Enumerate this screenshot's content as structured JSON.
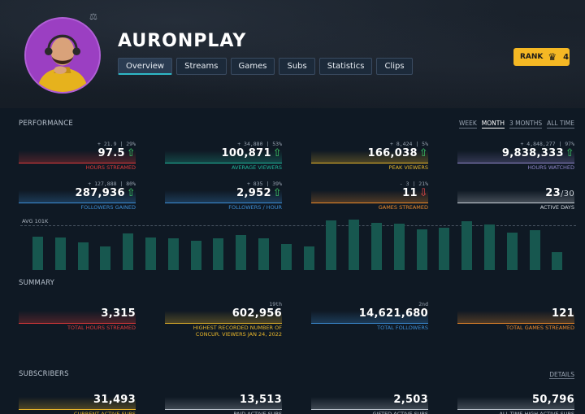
{
  "channel": {
    "name": "AURONPLAY"
  },
  "tabs": [
    {
      "label": "Overview",
      "active": true
    },
    {
      "label": "Streams",
      "active": false
    },
    {
      "label": "Games",
      "active": false
    },
    {
      "label": "Subs",
      "active": false
    },
    {
      "label": "Statistics",
      "active": false
    },
    {
      "label": "Clips",
      "active": false
    }
  ],
  "rank": {
    "label": "RANK",
    "value": "4",
    "icon": "crown-icon",
    "color": "#f5b824"
  },
  "performance": {
    "title": "PERFORMANCE",
    "ranges": [
      {
        "label": "WEEK",
        "active": false
      },
      {
        "label": "MONTH",
        "active": true
      },
      {
        "label": "3 MONTHS",
        "active": false
      },
      {
        "label": "ALL TIME",
        "active": false
      }
    ],
    "stats": [
      {
        "delta": "+ 21.9 | 29%",
        "value": "97.5",
        "trend": "up",
        "label": "HOURS STREAMED",
        "color": "#e23a3a"
      },
      {
        "delta": "+ 34,880 | 53%",
        "value": "100,871",
        "trend": "up",
        "label": "AVERAGE VIEWERS",
        "color": "#1fb59a"
      },
      {
        "delta": "+ 8,424 | 5%",
        "value": "166,038",
        "trend": "up",
        "label": "PEAK VIEWERS",
        "color": "#e8b62a"
      },
      {
        "delta": "+ 4,848,277 | 97%",
        "value": "9,838,333",
        "trend": "up",
        "label": "HOURS WATCHED",
        "color": "#8f86c9"
      },
      {
        "delta": "+ 127,888 | 80%",
        "value": "287,936",
        "trend": "up",
        "label": "FOLLOWERS GAINED",
        "color": "#3d8fd8"
      },
      {
        "delta": "+ 835 | 39%",
        "value": "2,952",
        "trend": "up",
        "label": "FOLLOWERS / HOUR",
        "color": "#3d8fd8"
      },
      {
        "delta": "- 3 | 21%",
        "value": "11",
        "trend": "down",
        "label": "GAMES STREAMED",
        "color": "#ef8b2a"
      },
      {
        "delta": "",
        "value": "23",
        "value_sub": "/30",
        "trend": "",
        "label": "ACTIVE DAYS",
        "color": "#cfd5dc"
      }
    ]
  },
  "chart_data": {
    "type": "bar",
    "avg_label": "AVG 101K",
    "avg_value": 101,
    "ylim": [
      0,
      125
    ],
    "values": [
      76,
      73,
      62,
      53,
      82,
      74,
      72,
      67,
      71,
      79,
      72,
      58,
      54,
      112,
      114,
      107,
      104,
      92,
      95,
      110,
      103,
      84,
      90,
      41
    ],
    "bar_color": "#17574f"
  },
  "summary": {
    "title": "SUMMARY",
    "stats": [
      {
        "rank": "",
        "value": "3,315",
        "label": "TOTAL HOURS STREAMED",
        "color": "#e23a3a"
      },
      {
        "rank": "19th",
        "value": "602,956",
        "label": "HIGHEST RECORDED NUMBER OF",
        "label2": "CONCUR. VIEWERS JAN 24, 2022",
        "color": "#e8b62a"
      },
      {
        "rank": "2nd",
        "value": "14,621,680",
        "label": "TOTAL FOLLOWERS",
        "color": "#3d8fd8"
      },
      {
        "rank": "",
        "value": "121",
        "label": "TOTAL GAMES STREAMED",
        "color": "#ef8b2a"
      }
    ]
  },
  "subscribers": {
    "title": "SUBSCRIBERS",
    "details_label": "DETAILS",
    "stats": [
      {
        "value": "31,493",
        "label": "CURRENT ACTIVE SUBS",
        "color": "#e8b62a"
      },
      {
        "value": "13,513",
        "label": "PAID ACTIVE SUBS",
        "color": "#b8c0ca"
      },
      {
        "value": "2,503",
        "label": "GIFTED ACTIVE SUBS",
        "color": "#b8c0ca"
      },
      {
        "value": "50,796",
        "label": "ALL-TIME HIGH ACTIVE SUBS",
        "color": "#b8c0ca"
      }
    ]
  }
}
